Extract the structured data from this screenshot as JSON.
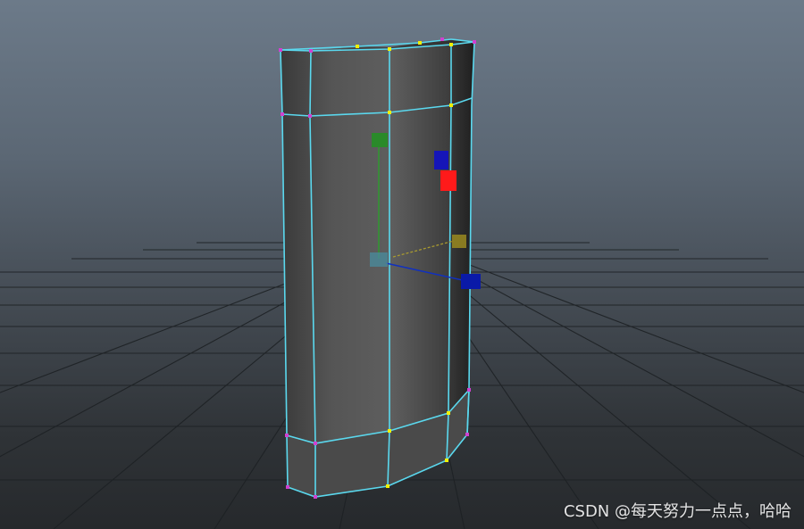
{
  "watermark": {
    "text": "CSDN @每天努力一点点，哈哈"
  },
  "colors": {
    "background_top": "#6c7a89",
    "background_bottom": "#26292c",
    "grid": "#1f2326",
    "mesh_face_light": "#8a8a8a",
    "mesh_face_dark": "#2a2a2a",
    "wire": "#58d9f0",
    "vertex_yellow": "#f0f000",
    "vertex_magenta": "#d040d0",
    "gizmo_y": "#2a8a2a",
    "gizmo_x": "#ff1a1a",
    "gizmo_z": "#0a1aa8",
    "gizmo_center": "#4a8a9a",
    "gizmo_yellow": "#9a8a20"
  },
  "icons": {
    "gizmo": "manipulator-icon"
  }
}
